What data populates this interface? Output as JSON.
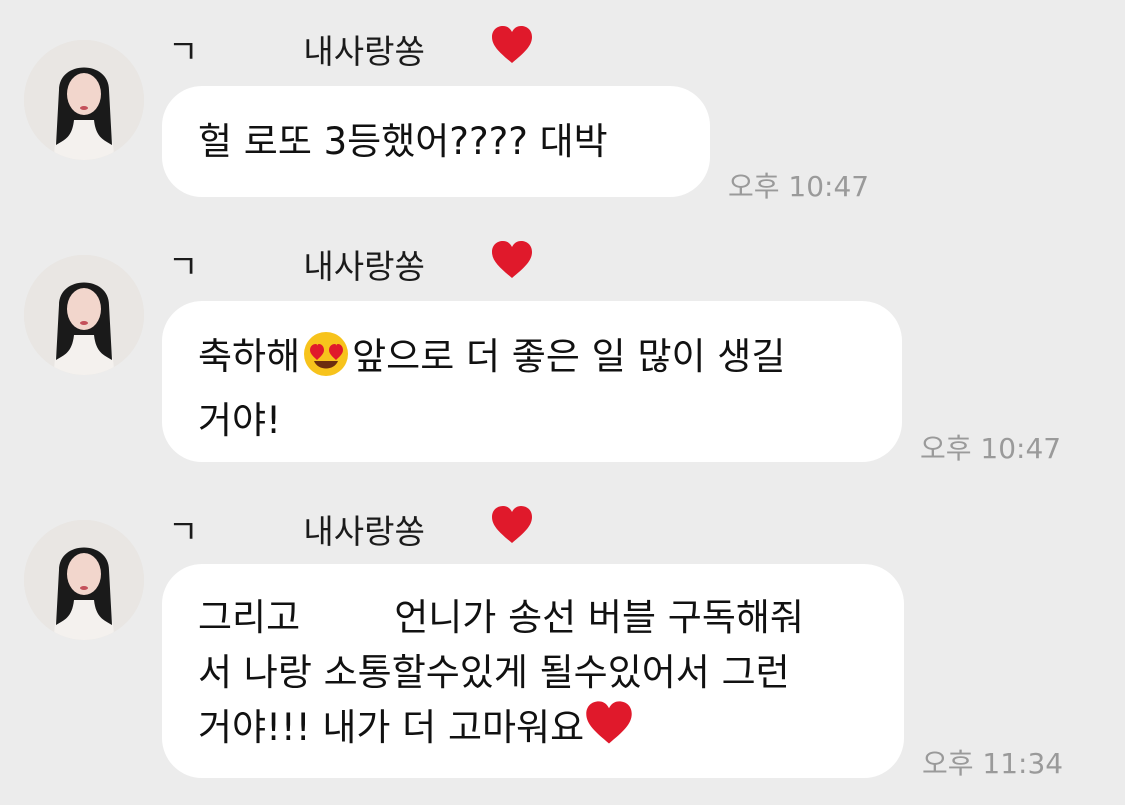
{
  "messages": [
    {
      "sender_prefix": "ㄱ",
      "sender_name": "내사랑쏭",
      "lines": [
        "헐 로또 3등했어???? 대박"
      ],
      "time": "오후 10:47"
    },
    {
      "sender_prefix": "ㄱ",
      "sender_name": "내사랑쏭",
      "line1_before": "축하해",
      "line1_after": "앞으로 더 좋은 일 많이 생길",
      "line2": "거야!",
      "time": "오후 10:47"
    },
    {
      "sender_prefix": "ㄱ",
      "sender_name": "내사랑쏭",
      "line1": "그리고        언니가 송선 버블 구독해줘",
      "line2": "서 나랑 소통할수있게 될수있어서 그런",
      "line3": "거야!!! 내가 더 고마워요",
      "time": "오후 11:34"
    }
  ],
  "icons": {
    "heart": "red-heart-icon",
    "emoji": "heart-eyes-emoji-icon"
  },
  "colors": {
    "background": "#ececec",
    "bubble": "#ffffff",
    "heart": "#e0192b",
    "timestamp": "#9a9a9a"
  }
}
